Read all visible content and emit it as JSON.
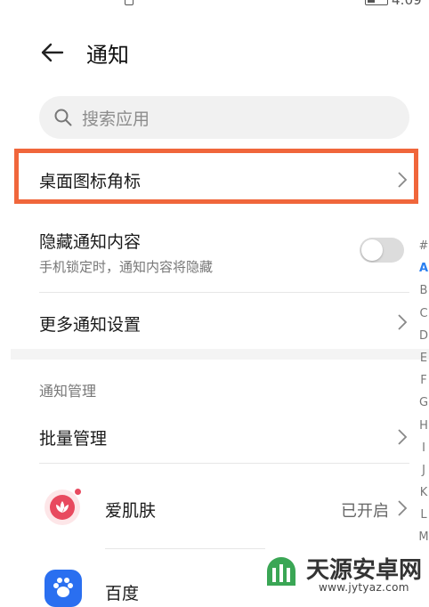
{
  "status_bar": {
    "time": "4:09"
  },
  "header": {
    "title": "通知"
  },
  "search": {
    "placeholder": "搜索应用"
  },
  "rows": {
    "badge": {
      "label": "桌面图标角标"
    },
    "hide_content": {
      "label": "隐藏通知内容",
      "subtitle": "手机锁定时，通知内容将隐藏",
      "enabled": false
    },
    "more_settings": {
      "label": "更多通知设置"
    }
  },
  "section": {
    "title": "通知管理"
  },
  "batch": {
    "label": "批量管理"
  },
  "apps": [
    {
      "name": "爱肌肤",
      "status": "已开启",
      "icon": "lotus-icon"
    },
    {
      "name": "百度",
      "status": "",
      "icon": "paw-icon"
    }
  ],
  "alphabet": [
    "#",
    "A",
    "B",
    "C",
    "D",
    "E",
    "F",
    "G",
    "H",
    "I",
    "J",
    "K",
    "L",
    "M"
  ],
  "alphabet_active": "A",
  "watermark": {
    "text": "天源安卓网",
    "url": "www.jytyaz.com"
  },
  "colors": {
    "highlight": "#f0663b",
    "accent": "#2a7ff0"
  }
}
